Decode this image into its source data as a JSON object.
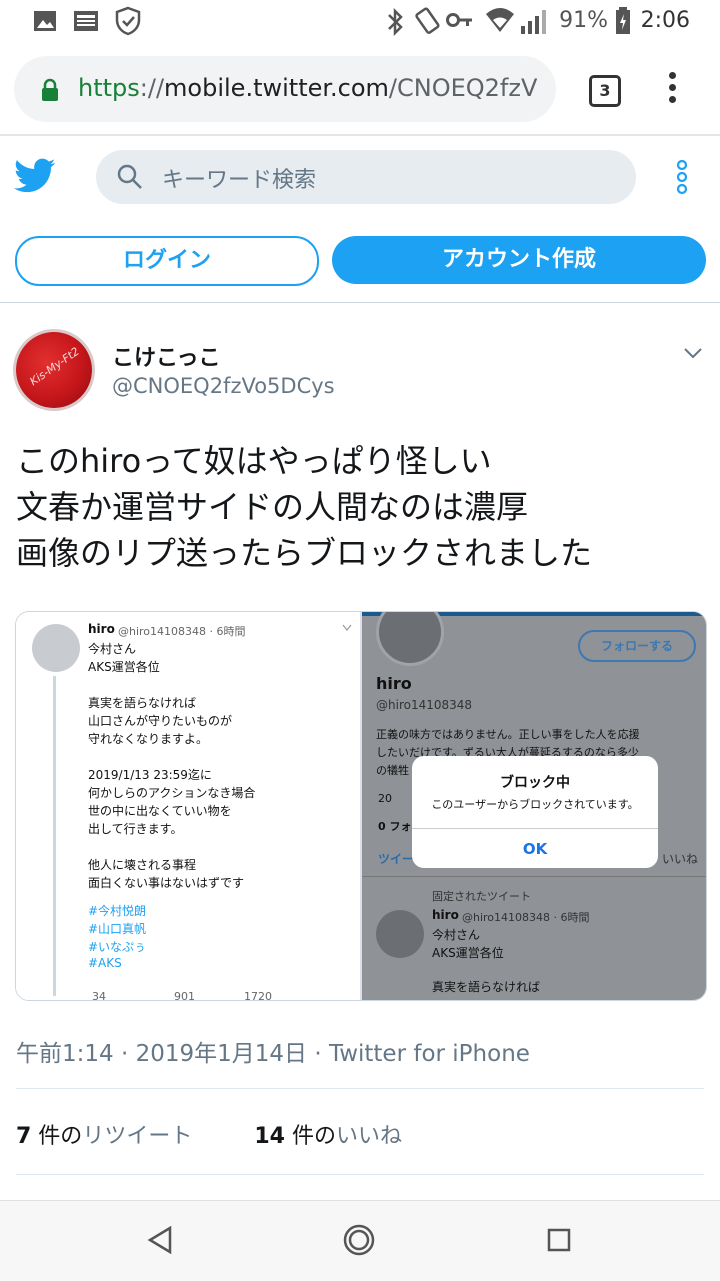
{
  "status_bar": {
    "battery": "91%",
    "time": "2:06",
    "icons": [
      "photo-icon",
      "news-icon",
      "shield-icon",
      "bluetooth-icon",
      "vibrate-icon",
      "key-icon",
      "wifi-icon",
      "signal-icon",
      "battery-icon"
    ]
  },
  "browser": {
    "url_scheme": "https",
    "url_sep": "://",
    "url_domain": "mobile.twitter.com",
    "url_path": "/CNOEQ2fzV",
    "tab_count": "3"
  },
  "header": {
    "search_placeholder": "キーワード検索",
    "login_label": "ログイン",
    "signup_label": "アカウント作成",
    "brand_color": "#1da1f2"
  },
  "tweet": {
    "display_name": "こけこっこ",
    "handle": "@CNOEQ2fzVo5DCys",
    "avatar_text": "Kis-My-Ft2",
    "lines": [
      "このhiroって奴はやっぱり怪しい",
      "文春か運営サイドの人間なのは濃厚",
      "画像のリプ送ったらブロックされました"
    ],
    "timestamp": "午前1:14 · 2019年1月14日 · Twitter for iPhone",
    "retweets_count": "7",
    "retweets_label_pre": " 件の",
    "retweets_label": "リツイート",
    "likes_count": "14",
    "likes_label_pre": " 件の",
    "likes_label": "いいね"
  },
  "media": {
    "left": {
      "name": "hiro",
      "meta": "@hiro14108348 · 6時間",
      "lines": [
        "今村さん",
        "AKS運営各位",
        "",
        "真実を語らなければ",
        "山口さんが守りたいものが",
        "守れなくなりますよ。",
        "",
        "2019/1/13 23:59迄に",
        "何かしらのアクションなき場合",
        "世の中に出なくていい物を",
        "出して行きます。",
        "",
        "他人に壊される事程",
        "面白くない事はないはずです"
      ],
      "hashtags": [
        "#今村悦朗",
        "#山口真帆",
        "#いなぷぅ",
        "#AKS"
      ],
      "counts": [
        "34",
        "901",
        "1720"
      ]
    },
    "right": {
      "follow_label": "フォローする",
      "name": "hiro",
      "handle": "@hiro14108348",
      "bio1": "正義の味方ではありません。正しい事をした人を応援",
      "bio2": "したいだけです。ずるい大人が蔓延るするのなら多少",
      "bio3": "の犠牲",
      "date_partial": "20",
      "follow_partial": "0 フォ",
      "tab_partial": "ツイー",
      "likes_tab_partial": "いいね",
      "pinned": "固定されたツイート",
      "tweet_name": "hiro",
      "tweet_meta": "@hiro14108348 · 6時間",
      "tweet_l1": "今村さん",
      "tweet_l2": "AKS運営各位",
      "tweet_l3": "真実を語らなければ",
      "dialog_title": "ブロック中",
      "dialog_message": "このユーザーからブロックされています。",
      "dialog_ok": "OK"
    }
  },
  "nav": {
    "icons": [
      "back-icon",
      "home-icon",
      "recents-icon"
    ]
  }
}
